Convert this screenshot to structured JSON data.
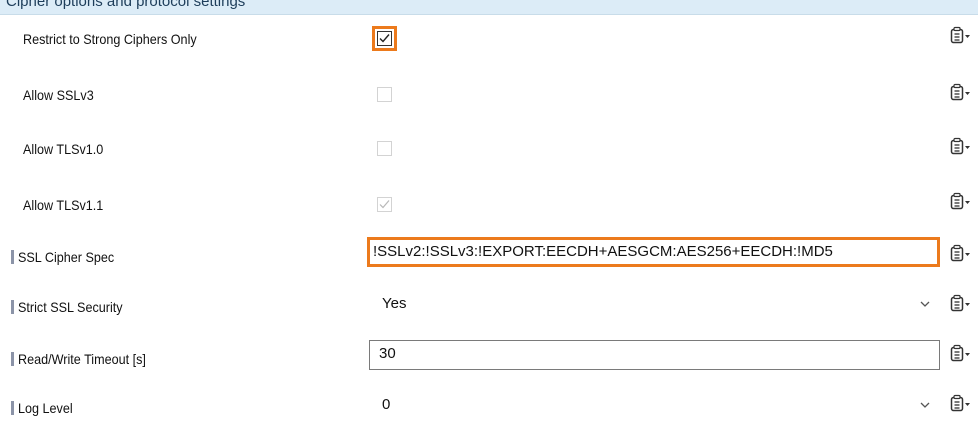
{
  "header": {
    "partial_text": "Cipher options and protocol settings"
  },
  "settings": [
    {
      "label": "Restrict to Strong Ciphers Only",
      "control": "checkbox",
      "checked": true,
      "enabled": true,
      "highlighted": true
    },
    {
      "label": "Allow SSLv3",
      "control": "checkbox",
      "checked": false,
      "enabled": false
    },
    {
      "label": "Allow TLSv1.0",
      "control": "checkbox",
      "checked": false,
      "enabled": false
    },
    {
      "label": "Allow TLSv1.1",
      "control": "checkbox",
      "checked": true,
      "enabled": false
    },
    {
      "label": "SSL Cipher Spec",
      "control": "text",
      "value": "!SSLv2:!SSLv3:!EXPORT:EECDH+AESGCM:AES256+EECDH:!MD5",
      "highlighted": true,
      "marked": true
    },
    {
      "label": "Strict SSL Security",
      "control": "dropdown",
      "value": "Yes",
      "marked": true
    },
    {
      "label": "Read/Write Timeout [s]",
      "control": "text",
      "value": "30",
      "marked": true
    },
    {
      "label": "Log Level",
      "control": "dropdown",
      "value": "0",
      "marked": true
    }
  ],
  "icons": {
    "options_menu": "clipboard-list-dropdown-icon",
    "checkmark": "checkmark-icon",
    "dropdown": "chevron-down-icon",
    "marker": "inheritance-marker"
  },
  "colors": {
    "highlight": "#ec7a1c",
    "marker": "#8c94a8",
    "header_bg": "#dcecf7"
  }
}
